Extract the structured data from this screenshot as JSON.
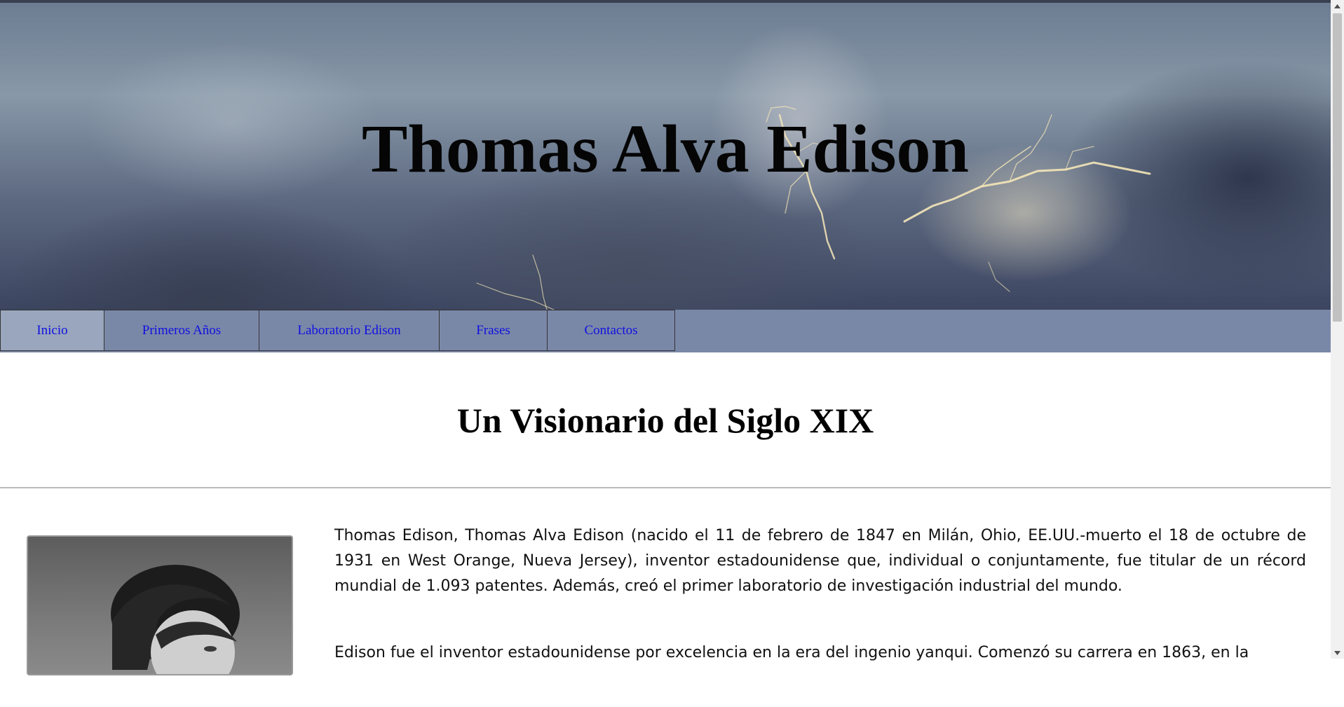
{
  "header": {
    "title": "Thomas Alva Edison"
  },
  "nav": {
    "items": [
      {
        "label": "Inicio",
        "active": true
      },
      {
        "label": "Primeros Años",
        "active": false
      },
      {
        "label": "Laboratorio Edison",
        "active": false
      },
      {
        "label": "Frases",
        "active": false
      },
      {
        "label": "Contactos",
        "active": false
      }
    ]
  },
  "main": {
    "section_title": "Un Visionario del Siglo XIX",
    "paragraphs": [
      "Thomas Edison, Thomas Alva Edison (nacido el 11 de febrero de 1847 en Milán, Ohio, EE.UU.-muerto el 18 de octubre de 1931 en West Orange, Nueva Jersey), inventor estadounidense que, individual o conjuntamente, fue titular de un récord mundial de 1.093 patentes. Además, creó el primer laboratorio de investigación industrial del mundo.",
      "Edison fue el inventor estadounidense por excelencia en la era del ingenio yanqui. Comenzó su carrera en 1863, en la"
    ]
  },
  "colors": {
    "nav_background": "#7a88a8",
    "nav_active": "#99a6bd",
    "link": "#1010e0"
  },
  "icons": {
    "scroll_up": "triangle-up",
    "scroll_down": "triangle-down"
  }
}
